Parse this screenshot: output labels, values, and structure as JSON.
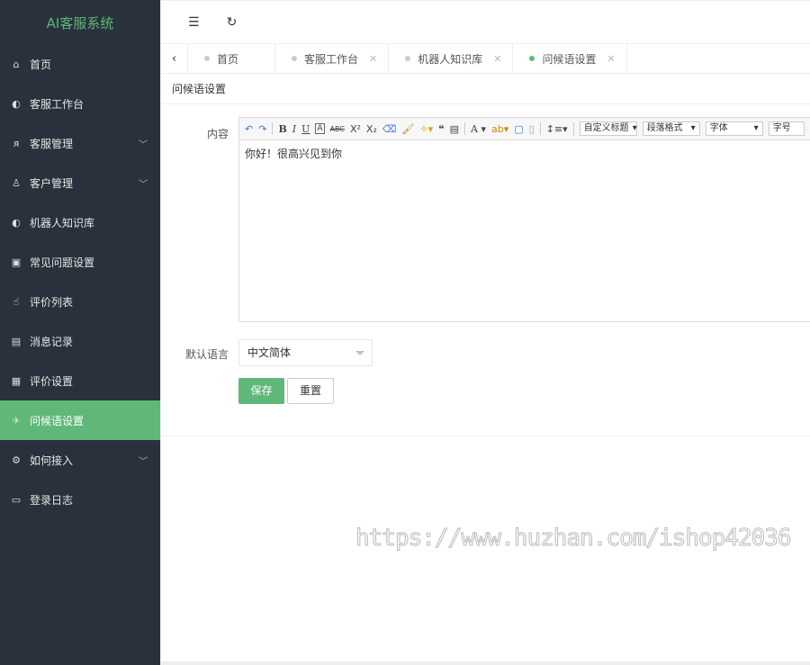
{
  "app": {
    "title": "AI客服系统"
  },
  "sidebar": {
    "items": [
      {
        "label": "首页",
        "icon": "home-icon",
        "glyph": "⌂"
      },
      {
        "label": "客服工作台",
        "icon": "headset-icon",
        "glyph": "◐"
      },
      {
        "label": "客服管理",
        "icon": "user-icon",
        "glyph": "ᴙ",
        "expand": true
      },
      {
        "label": "客户管理",
        "icon": "users-icon",
        "glyph": "♙",
        "expand": true
      },
      {
        "label": "机器人知识库",
        "icon": "headset-icon",
        "glyph": "◐"
      },
      {
        "label": "常见问题设置",
        "icon": "question-doc-icon",
        "glyph": "▣"
      },
      {
        "label": "评价列表",
        "icon": "thumb-up-icon",
        "glyph": "☝"
      },
      {
        "label": "消息记录",
        "icon": "doc-icon",
        "glyph": "▤"
      },
      {
        "label": "评价设置",
        "icon": "calendar-icon",
        "glyph": "▦"
      },
      {
        "label": "问候语设置",
        "icon": "send-icon",
        "glyph": "✈",
        "active": true
      },
      {
        "label": "如何接入",
        "icon": "gear-icon",
        "glyph": "⚙",
        "expand": true
      },
      {
        "label": "登录日志",
        "icon": "table-icon",
        "glyph": "▭"
      }
    ]
  },
  "topbar": {
    "menu_icon": "☰",
    "refresh_icon": "↻"
  },
  "tabs": [
    {
      "label": "首页",
      "closable": false
    },
    {
      "label": "客服工作台",
      "closable": true
    },
    {
      "label": "机器人知识库",
      "closable": true
    },
    {
      "label": "问候语设置",
      "closable": true,
      "active": true
    }
  ],
  "breadcrumb": "问候语设置",
  "form": {
    "content_label": "内容",
    "content_value": "你好！很高兴见到你",
    "toolbar": {
      "heading": "自定义标题",
      "paragraph": "段落格式",
      "font": "字体",
      "size": "字号"
    },
    "language_label": "默认语言",
    "language_value": "中文简体",
    "save": "保存",
    "reset": "重置"
  },
  "watermark": "https://www.huzhan.com/ishop42036",
  "colors": {
    "accent": "#5fb878",
    "sidebar": "#29323c"
  }
}
